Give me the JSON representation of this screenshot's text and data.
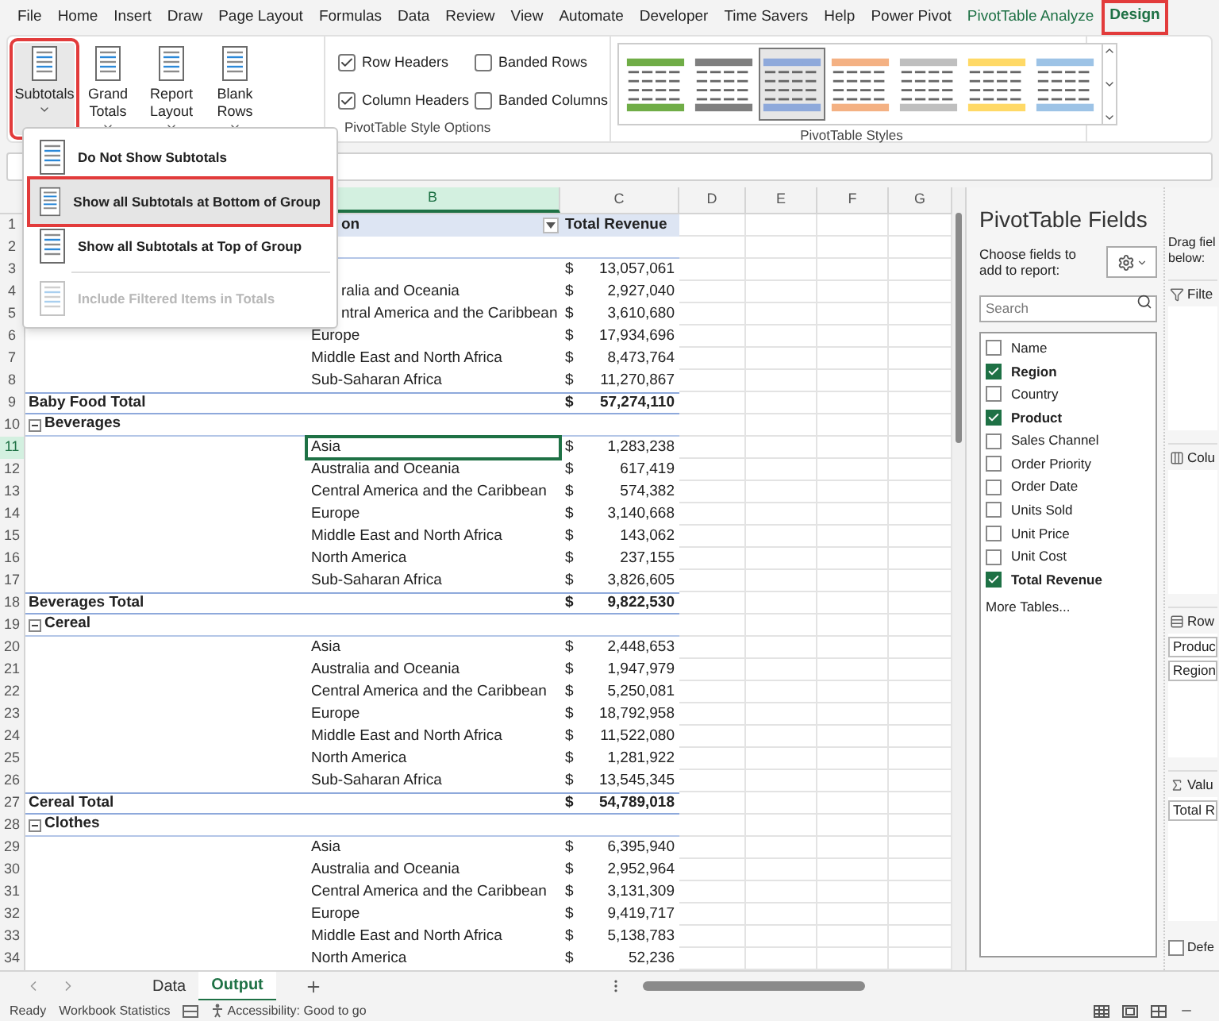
{
  "ribbon_tabs": [
    {
      "label": "File",
      "kind": "normal",
      "selected": false,
      "highlighted": false
    },
    {
      "label": "Home",
      "kind": "normal",
      "selected": false,
      "highlighted": false
    },
    {
      "label": "Insert",
      "kind": "normal",
      "selected": false,
      "highlighted": false
    },
    {
      "label": "Draw",
      "kind": "normal",
      "selected": false,
      "highlighted": false
    },
    {
      "label": "Page Layout",
      "kind": "normal",
      "selected": false,
      "highlighted": false
    },
    {
      "label": "Formulas",
      "kind": "normal",
      "selected": false,
      "highlighted": false
    },
    {
      "label": "Data",
      "kind": "normal",
      "selected": false,
      "highlighted": false
    },
    {
      "label": "Review",
      "kind": "normal",
      "selected": false,
      "highlighted": false
    },
    {
      "label": "View",
      "kind": "normal",
      "selected": false,
      "highlighted": false
    },
    {
      "label": "Automate",
      "kind": "normal",
      "selected": false,
      "highlighted": false
    },
    {
      "label": "Developer",
      "kind": "normal",
      "selected": false,
      "highlighted": false
    },
    {
      "label": "Time Savers",
      "kind": "normal",
      "selected": false,
      "highlighted": false
    },
    {
      "label": "Help",
      "kind": "normal",
      "selected": false,
      "highlighted": false
    },
    {
      "label": "Power Pivot",
      "kind": "normal",
      "selected": false,
      "highlighted": false
    },
    {
      "label": "PivotTable Analyze",
      "kind": "contextual",
      "selected": false,
      "highlighted": false
    },
    {
      "label": "Design",
      "kind": "contextual",
      "selected": true,
      "highlighted": true
    }
  ],
  "layout_buttons": [
    {
      "label": "Subtotals",
      "highlighted": true
    },
    {
      "label": "Grand Totals",
      "highlighted": false
    },
    {
      "label": "Report Layout",
      "highlighted": false
    },
    {
      "label": "Blank Rows",
      "highlighted": false
    }
  ],
  "style_options": {
    "label": "PivotTable Style Options",
    "items": [
      {
        "label": "Row Headers",
        "checked": true
      },
      {
        "label": "Banded Rows",
        "checked": false
      },
      {
        "label": "Column Headers",
        "checked": true
      },
      {
        "label": "Banded Columns",
        "checked": false
      }
    ]
  },
  "styles": {
    "label": "PivotTable Styles",
    "swatches": [
      {
        "color": "#70ad47",
        "selected": false
      },
      {
        "color": "#7f7f7f",
        "selected": false
      },
      {
        "color": "#8ea9db",
        "selected": true
      },
      {
        "color": "#f4b183",
        "selected": false
      },
      {
        "color": "#bfbfbf",
        "selected": false
      },
      {
        "color": "#ffd966",
        "selected": false
      },
      {
        "color": "#9dc3e6",
        "selected": false
      }
    ]
  },
  "subtotals_menu": [
    {
      "label": "Do Not Show Subtotals",
      "highlighted": false,
      "disabled": false
    },
    {
      "label": "Show all Subtotals at Bottom of Group",
      "highlighted": true,
      "disabled": false
    },
    {
      "label": "Show all Subtotals at Top of Group",
      "highlighted": false,
      "disabled": false
    },
    {
      "label": "Include Filtered Items in Totals",
      "highlighted": false,
      "disabled": true
    }
  ],
  "columns": [
    {
      "label": "B",
      "selected": true
    },
    {
      "label": "C",
      "selected": false
    },
    {
      "label": "D",
      "selected": false
    },
    {
      "label": "E",
      "selected": false
    },
    {
      "label": "F",
      "selected": false
    },
    {
      "label": "G",
      "selected": false
    }
  ],
  "rows": [
    {
      "number": "1",
      "kind": "header",
      "region": "on",
      "covered": true,
      "amount": "Total Revenue",
      "selected": false
    },
    {
      "number": "2",
      "kind": "group",
      "selected": false
    },
    {
      "number": "3",
      "kind": "item",
      "currency": "$",
      "amount": "13,057,061",
      "selected": false
    },
    {
      "number": "4",
      "kind": "item",
      "region": "ralia and Oceania",
      "covered": true,
      "currency": "$",
      "amount": "2,927,040",
      "selected": false
    },
    {
      "number": "5",
      "kind": "item",
      "region": "ntral America and the Caribbean",
      "covered": true,
      "currency": "$",
      "amount": "3,610,680",
      "selected": false
    },
    {
      "number": "6",
      "kind": "item",
      "region": "Europe",
      "currency": "$",
      "amount": "17,934,696",
      "selected": false
    },
    {
      "number": "7",
      "kind": "item",
      "region": "Middle East and North Africa",
      "currency": "$",
      "amount": "8,473,764",
      "selected": false
    },
    {
      "number": "8",
      "kind": "item",
      "region": "Sub-Saharan Africa",
      "currency": "$",
      "amount": "11,270,867",
      "selected": false
    },
    {
      "number": "9",
      "kind": "total",
      "label": "Baby Food Total",
      "currency": "$",
      "amount": "57,274,110",
      "selected": false
    },
    {
      "number": "10",
      "kind": "group",
      "label": "Beverages",
      "selected": false
    },
    {
      "number": "11",
      "kind": "item",
      "region": "Asia",
      "currency": "$",
      "amount": "1,283,238",
      "selected": true
    },
    {
      "number": "12",
      "kind": "item",
      "region": "Australia and Oceania",
      "currency": "$",
      "amount": "617,419",
      "selected": false
    },
    {
      "number": "13",
      "kind": "item",
      "region": "Central America and the Caribbean",
      "currency": "$",
      "amount": "574,382",
      "selected": false
    },
    {
      "number": "14",
      "kind": "item",
      "region": "Europe",
      "currency": "$",
      "amount": "3,140,668",
      "selected": false
    },
    {
      "number": "15",
      "kind": "item",
      "region": "Middle East and North Africa",
      "currency": "$",
      "amount": "143,062",
      "selected": false
    },
    {
      "number": "16",
      "kind": "item",
      "region": "North America",
      "currency": "$",
      "amount": "237,155",
      "selected": false
    },
    {
      "number": "17",
      "kind": "item",
      "region": "Sub-Saharan Africa",
      "currency": "$",
      "amount": "3,826,605",
      "selected": false
    },
    {
      "number": "18",
      "kind": "total",
      "label": "Beverages Total",
      "currency": "$",
      "amount": "9,822,530",
      "selected": false
    },
    {
      "number": "19",
      "kind": "group",
      "label": "Cereal",
      "selected": false
    },
    {
      "number": "20",
      "kind": "item",
      "region": "Asia",
      "currency": "$",
      "amount": "2,448,653",
      "selected": false
    },
    {
      "number": "21",
      "kind": "item",
      "region": "Australia and Oceania",
      "currency": "$",
      "amount": "1,947,979",
      "selected": false
    },
    {
      "number": "22",
      "kind": "item",
      "region": "Central America and the Caribbean",
      "currency": "$",
      "amount": "5,250,081",
      "selected": false
    },
    {
      "number": "23",
      "kind": "item",
      "region": "Europe",
      "currency": "$",
      "amount": "18,792,958",
      "selected": false
    },
    {
      "number": "24",
      "kind": "item",
      "region": "Middle East and North Africa",
      "currency": "$",
      "amount": "11,522,080",
      "selected": false
    },
    {
      "number": "25",
      "kind": "item",
      "region": "North America",
      "currency": "$",
      "amount": "1,281,922",
      "selected": false
    },
    {
      "number": "26",
      "kind": "item",
      "region": "Sub-Saharan Africa",
      "currency": "$",
      "amount": "13,545,345",
      "selected": false
    },
    {
      "number": "27",
      "kind": "total",
      "label": "Cereal Total",
      "currency": "$",
      "amount": "54,789,018",
      "selected": false
    },
    {
      "number": "28",
      "kind": "group",
      "label": "Clothes",
      "selected": false
    },
    {
      "number": "29",
      "kind": "item",
      "region": "Asia",
      "currency": "$",
      "amount": "6,395,940",
      "selected": false
    },
    {
      "number": "30",
      "kind": "item",
      "region": "Australia and Oceania",
      "currency": "$",
      "amount": "2,952,964",
      "selected": false
    },
    {
      "number": "31",
      "kind": "item",
      "region": "Central America and the Caribbean",
      "currency": "$",
      "amount": "3,131,309",
      "selected": false
    },
    {
      "number": "32",
      "kind": "item",
      "region": "Europe",
      "currency": "$",
      "amount": "9,419,717",
      "selected": false
    },
    {
      "number": "33",
      "kind": "item",
      "region": "Middle East and North Africa",
      "currency": "$",
      "amount": "5,138,783",
      "selected": false
    },
    {
      "number": "34",
      "kind": "item",
      "region": "North America",
      "currency": "$",
      "amount": "52,236",
      "selected": false
    }
  ],
  "sheet_tabs": [
    {
      "label": "Data",
      "selected": false
    },
    {
      "label": "Output",
      "selected": true
    }
  ],
  "status_bar": {
    "state": "Ready",
    "statistics": "Workbook Statistics",
    "accessibility": "Accessibility: Good to go"
  },
  "field_pane": {
    "title": "PivotTable Fields",
    "instruction": "Choose fields to add to report:",
    "search": {
      "placeholder": "Search"
    },
    "fields": [
      {
        "label": "Name",
        "checked": false
      },
      {
        "label": "Region",
        "checked": true
      },
      {
        "label": "Country",
        "checked": false
      },
      {
        "label": "Product",
        "checked": true
      },
      {
        "label": "Sales Channel",
        "checked": false
      },
      {
        "label": "Order Priority",
        "checked": false
      },
      {
        "label": "Order Date",
        "checked": false
      },
      {
        "label": "Units Sold",
        "checked": false
      },
      {
        "label": "Unit Price",
        "checked": false
      },
      {
        "label": "Unit Cost",
        "checked": false
      },
      {
        "label": "Total Revenue",
        "checked": true
      }
    ],
    "more_tables": "More Tables...",
    "drag_hint": "Drag fiel",
    "drag_hint_2": "below:",
    "areas": [
      {
        "kind": "filters",
        "label": "Filte"
      },
      {
        "kind": "columns",
        "label": "Colu"
      },
      {
        "kind": "rows",
        "label": "Row",
        "items": [
          "Produc",
          "Region"
        ]
      },
      {
        "kind": "values",
        "label": "Valu",
        "items": [
          "Total R"
        ]
      }
    ],
    "defer": {
      "label": "Defe",
      "checked": false
    }
  }
}
